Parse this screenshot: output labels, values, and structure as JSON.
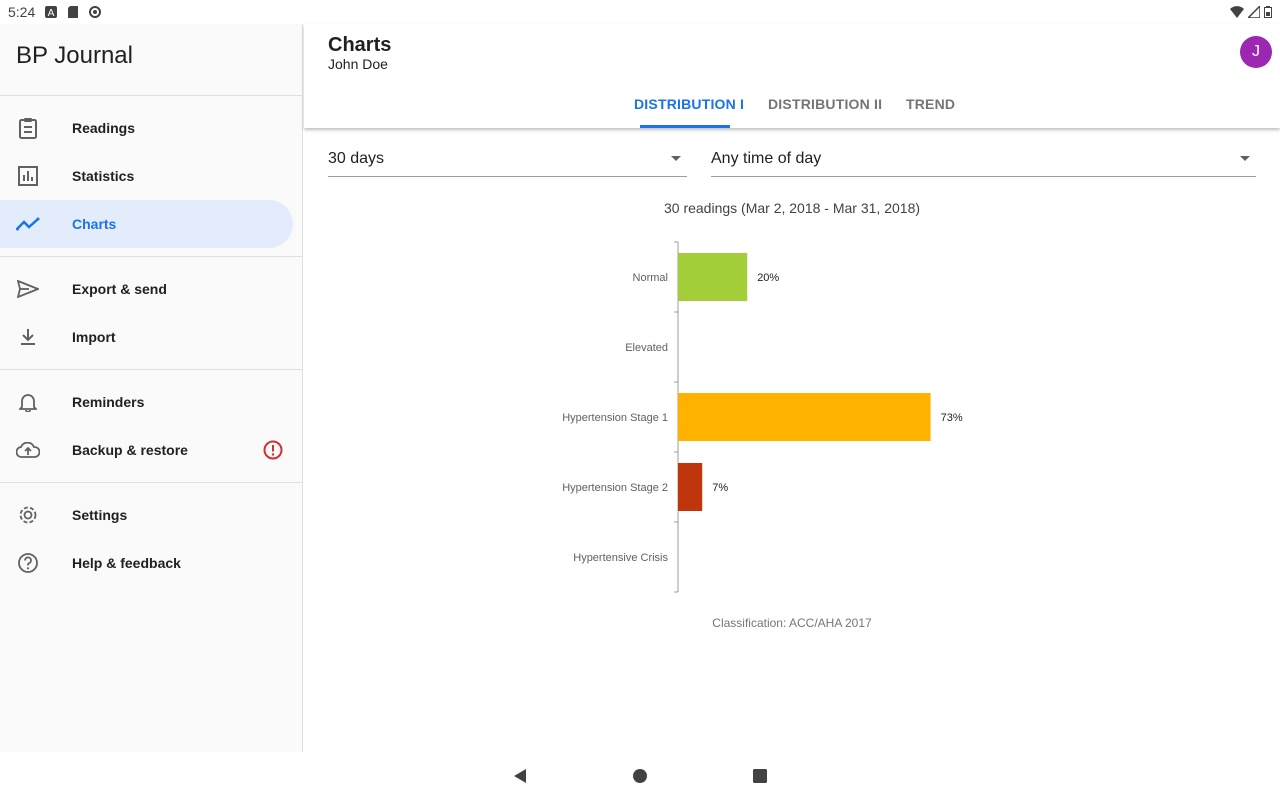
{
  "status_bar": {
    "time": "5:24"
  },
  "drawer": {
    "title": "BP Journal",
    "groups": [
      [
        {
          "label": "Readings",
          "icon": "clipboard-icon"
        },
        {
          "label": "Statistics",
          "icon": "statistics-icon"
        },
        {
          "label": "Charts",
          "icon": "trend-icon",
          "active": true
        }
      ],
      [
        {
          "label": "Export & send",
          "icon": "send-icon"
        },
        {
          "label": "Import",
          "icon": "download-icon"
        }
      ],
      [
        {
          "label": "Reminders",
          "icon": "bell-icon"
        },
        {
          "label": "Backup & restore",
          "icon": "cloud-upload-icon",
          "alert": true
        }
      ],
      [
        {
          "label": "Settings",
          "icon": "gear-icon"
        },
        {
          "label": "Help & feedback",
          "icon": "help-icon"
        }
      ]
    ]
  },
  "header": {
    "title": "Charts",
    "subtitle": "John Doe",
    "avatar_letter": "J",
    "avatar_color": "#9c27b0"
  },
  "tabs": [
    {
      "label": "DISTRIBUTION I",
      "active": true
    },
    {
      "label": "DISTRIBUTION II",
      "active": false
    },
    {
      "label": "TREND",
      "active": false
    }
  ],
  "filters": {
    "period": "30 days",
    "time_of_day": "Any time of day"
  },
  "chart_data": {
    "type": "bar",
    "orientation": "horizontal",
    "title": "30 readings (Mar 2, 2018 - Mar 31, 2018)",
    "categories": [
      "Normal",
      "Elevated",
      "Hypertension Stage 1",
      "Hypertension Stage 2",
      "Hypertensive Crisis"
    ],
    "values": [
      20,
      0,
      73,
      7,
      0
    ],
    "value_labels": [
      "20%",
      "",
      "73%",
      "7%",
      ""
    ],
    "colors": [
      "#a4ce39",
      "#a4ce39",
      "#ffb300",
      "#bf360c",
      "#b71c1c"
    ],
    "unit": "%",
    "xlim": [
      0,
      100
    ],
    "footer": "Classification: ACC/AHA 2017"
  }
}
